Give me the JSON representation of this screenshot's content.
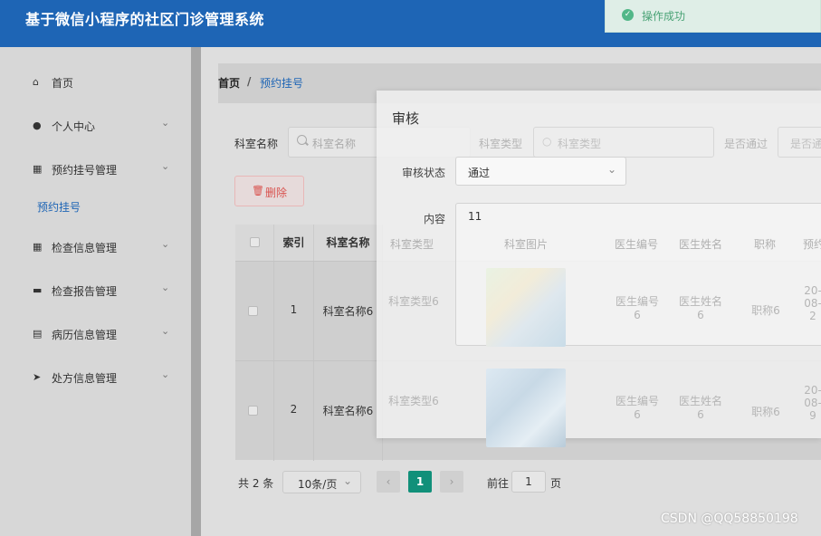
{
  "header": {
    "title": "基于微信小程序的社区门诊管理系统"
  },
  "toast": {
    "message": "操作成功",
    "icon": "success-check-icon",
    "color": "#52b788"
  },
  "sidebar": {
    "items": [
      {
        "label": "首页",
        "icon": "home-icon"
      },
      {
        "label": "个人中心",
        "icon": "user-icon"
      },
      {
        "label": "预约挂号管理",
        "icon": "grid-icon"
      },
      {
        "label": "检查信息管理",
        "icon": "grid-icon"
      },
      {
        "label": "检查报告管理",
        "icon": "briefcase-icon"
      },
      {
        "label": "病历信息管理",
        "icon": "clipboard-icon"
      },
      {
        "label": "处方信息管理",
        "icon": "send-icon"
      }
    ],
    "active_sub": "预约挂号"
  },
  "breadcrumb": {
    "home": "首页",
    "separator": "/",
    "current": "预约挂号"
  },
  "search": {
    "dept_name_label": "科室名称",
    "dept_name_placeholder": "科室名称",
    "dept_type_label": "科室类型",
    "dept_type_placeholder": "科室类型",
    "passed_label": "是否通过",
    "passed_placeholder": "是否通"
  },
  "toolbar": {
    "delete_label": "删除"
  },
  "table": {
    "headers": [
      "索引",
      "科室名称",
      "科室类型",
      "科室图片",
      "医生编号",
      "医生姓名",
      "职称",
      "预约"
    ],
    "rows": [
      {
        "index": "1",
        "dept_name": "科室名称6",
        "dept_type": "科室类型6",
        "doctor_id": "医生编号6",
        "doctor_name": "医生姓名6",
        "title": "职称6",
        "date": "20-08-2"
      },
      {
        "index": "2",
        "dept_name": "科室名称6",
        "dept_type": "科室类型6",
        "doctor_id": "医生编号6",
        "doctor_name": "医生姓名6",
        "title": "职称6",
        "date": "20-08-9"
      }
    ]
  },
  "pagination": {
    "total": "共 2 条",
    "page_size": "10条/页",
    "prev": "‹",
    "current": "1",
    "next": "›",
    "goto_label": "前往",
    "goto_value": "1",
    "page_suffix": "页"
  },
  "dialog": {
    "title": "审核",
    "status_label": "审核状态",
    "status_value": "通过",
    "content_label": "内容",
    "content_value": "11"
  },
  "watermark": "CSDN @QQ58850198",
  "colors": {
    "header": "#1e65b5",
    "accent": "#11907a",
    "danger": "#d9534f"
  }
}
